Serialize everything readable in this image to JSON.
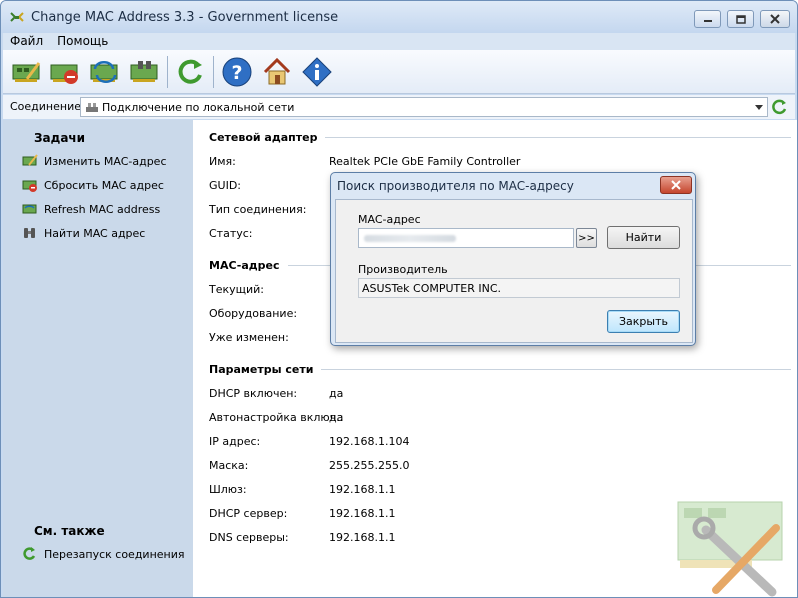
{
  "window": {
    "title": "Change MAC Address 3.3 - Government license",
    "minimize_icon": "minimize-icon",
    "maximize_icon": "maximize-icon",
    "close_icon": "close-icon"
  },
  "menu": [
    "Файл",
    "Помощь"
  ],
  "toolbar": {
    "buttons": [
      {
        "name": "change-mac-icon"
      },
      {
        "name": "reset-mac-icon"
      },
      {
        "name": "refresh-mac-icon"
      },
      {
        "name": "find-mac-icon"
      },
      {
        "name": "update-icon"
      },
      {
        "name": "help-icon"
      },
      {
        "name": "home-icon"
      },
      {
        "name": "info-icon"
      }
    ]
  },
  "connection": {
    "label": "Соединение:",
    "value": "Подключение по локальной сети"
  },
  "sidebar": {
    "tasks_heading": "Задачи",
    "tasks": [
      {
        "label": "Изменить MAC-адрес"
      },
      {
        "label": "Сбросить MAC адрес"
      },
      {
        "label": "Refresh MAC address"
      },
      {
        "label": "Найти MAC адрес"
      }
    ],
    "see_also_heading": "См. также",
    "see_also": [
      {
        "label": "Перезапуск соединения"
      }
    ]
  },
  "adapter": {
    "heading": "Сетевой адаптер",
    "rows": [
      {
        "label": "Имя:",
        "value": "Realtek PCIe GbE Family Controller"
      },
      {
        "label": "GUID:",
        "value": ""
      },
      {
        "label": "Тип соединения:",
        "value": ""
      },
      {
        "label": "Статус:",
        "value": ""
      }
    ]
  },
  "mac": {
    "heading": "MAC-адрес",
    "rows": [
      {
        "label": "Текущий:",
        "value": ""
      },
      {
        "label": "Оборудование:",
        "value": ""
      },
      {
        "label": "Уже изменен:",
        "value": ""
      }
    ]
  },
  "network": {
    "heading": "Параметры сети",
    "rows": [
      {
        "label": "DHCP включен:",
        "value": "да"
      },
      {
        "label": "Автонастройка включ.:",
        "value": "да"
      },
      {
        "label": "IP адрес:",
        "value": "192.168.1.104"
      },
      {
        "label": "Маска:",
        "value": "255.255.255.0"
      },
      {
        "label": "Шлюз:",
        "value": "192.168.1.1"
      },
      {
        "label": "DHCP сервер:",
        "value": "192.168.1.1"
      },
      {
        "label": "DNS серверы:",
        "value": "192.168.1.1"
      }
    ]
  },
  "dialog": {
    "title": "Поиск производителя по MAC-адресу",
    "mac_label": "MAC-адрес",
    "mac_value": "",
    "more_label": ">>",
    "find_label": "Найти",
    "vendor_label": "Производитель",
    "vendor_value": "ASUSTek COMPUTER INC.",
    "close_label": "Закрыть"
  },
  "colors": {
    "frame": "#c8daf0",
    "sidebar": "#cad9ea",
    "dialog_close": "#c5462e"
  }
}
